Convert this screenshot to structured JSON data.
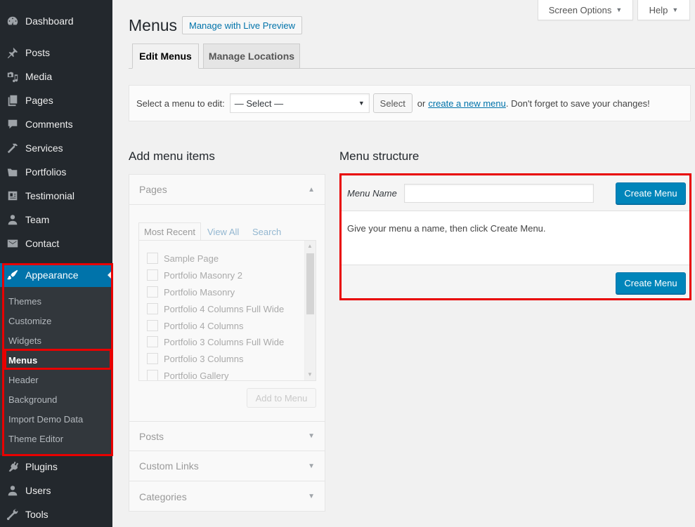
{
  "sidebar": {
    "items": [
      {
        "label": "Dashboard",
        "icon": "dashboard-icon"
      },
      {
        "label": "Posts",
        "icon": "pushpin-icon"
      },
      {
        "label": "Media",
        "icon": "media-icon"
      },
      {
        "label": "Pages",
        "icon": "pages-icon"
      },
      {
        "label": "Comments",
        "icon": "comment-icon"
      },
      {
        "label": "Services",
        "icon": "hammer-icon"
      },
      {
        "label": "Portfolios",
        "icon": "folder-icon"
      },
      {
        "label": "Testimonial",
        "icon": "id-card-icon"
      },
      {
        "label": "Team",
        "icon": "person-icon"
      },
      {
        "label": "Contact",
        "icon": "envelope-icon"
      }
    ],
    "appearance": {
      "label": "Appearance",
      "icon": "paintbrush-icon"
    },
    "submenu": [
      "Themes",
      "Customize",
      "Widgets",
      "Menus",
      "Header",
      "Background",
      "Import Demo Data",
      "Theme Editor"
    ],
    "current_submenu": "Menus",
    "bottom_items": [
      {
        "label": "Plugins",
        "icon": "plugin-icon"
      },
      {
        "label": "Users",
        "icon": "users-icon"
      },
      {
        "label": "Tools",
        "icon": "wrench-icon"
      }
    ]
  },
  "topbar": {
    "screen_options": "Screen Options",
    "help": "Help"
  },
  "header": {
    "title": "Menus",
    "live_preview_button": "Manage with Live Preview"
  },
  "tabs": [
    {
      "label": "Edit Menus",
      "active": true
    },
    {
      "label": "Manage Locations",
      "active": false
    }
  ],
  "manage_bar": {
    "label": "Select a menu to edit:",
    "select_value": "— Select —",
    "select_button": "Select",
    "or_text": "or",
    "create_link": "create a new menu",
    "suffix": ". Don't forget to save your changes!"
  },
  "add_items": {
    "title": "Add menu items",
    "sections": {
      "pages": "Pages",
      "posts": "Posts",
      "custom_links": "Custom Links",
      "categories": "Categories"
    },
    "inner_tabs": [
      "Most Recent",
      "View All",
      "Search"
    ],
    "pages_list": [
      "Sample Page",
      "Portfolio Masonry 2",
      "Portfolio Masonry",
      "Portfolio 4 Columns Full Wide",
      "Portfolio 4 Columns",
      "Portfolio 3 Columns Full Wide",
      "Portfolio 3 Columns",
      "Portfolio Gallery"
    ],
    "add_button": "Add to Menu"
  },
  "menu_structure": {
    "title": "Menu structure",
    "name_label": "Menu Name",
    "name_value": "",
    "create_button": "Create Menu",
    "instructions": "Give your menu a name, then click Create Menu."
  },
  "colors": {
    "sidebar_bg": "#23282d",
    "active_bg": "#0073aa",
    "submenu_bg": "#32373c",
    "primary_button": "#0085ba",
    "highlight": "#e80000"
  }
}
